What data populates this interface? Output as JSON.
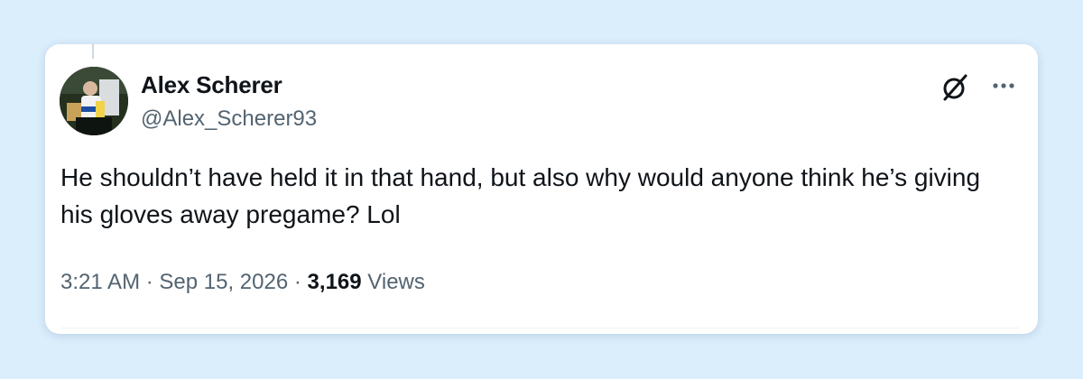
{
  "tweet": {
    "author": {
      "display_name": "Alex Scherer",
      "handle": "@Alex_Scherer93",
      "avatar_icon": "user-avatar"
    },
    "text": "He shouldn’t have held it in that hand, but also why would anyone think he’s giving his gloves away pregame? Lol",
    "time": "3:21 AM",
    "separator": "·",
    "date": "Sep 15, 2026",
    "views_count": "3,169",
    "views_label": "Views",
    "actions": {
      "grok_icon": "grok-icon",
      "more_icon": "more-options-icon"
    }
  },
  "colors": {
    "background": "#dbeefc",
    "card": "#ffffff",
    "text_primary": "#0f1419",
    "text_secondary": "#536471"
  }
}
